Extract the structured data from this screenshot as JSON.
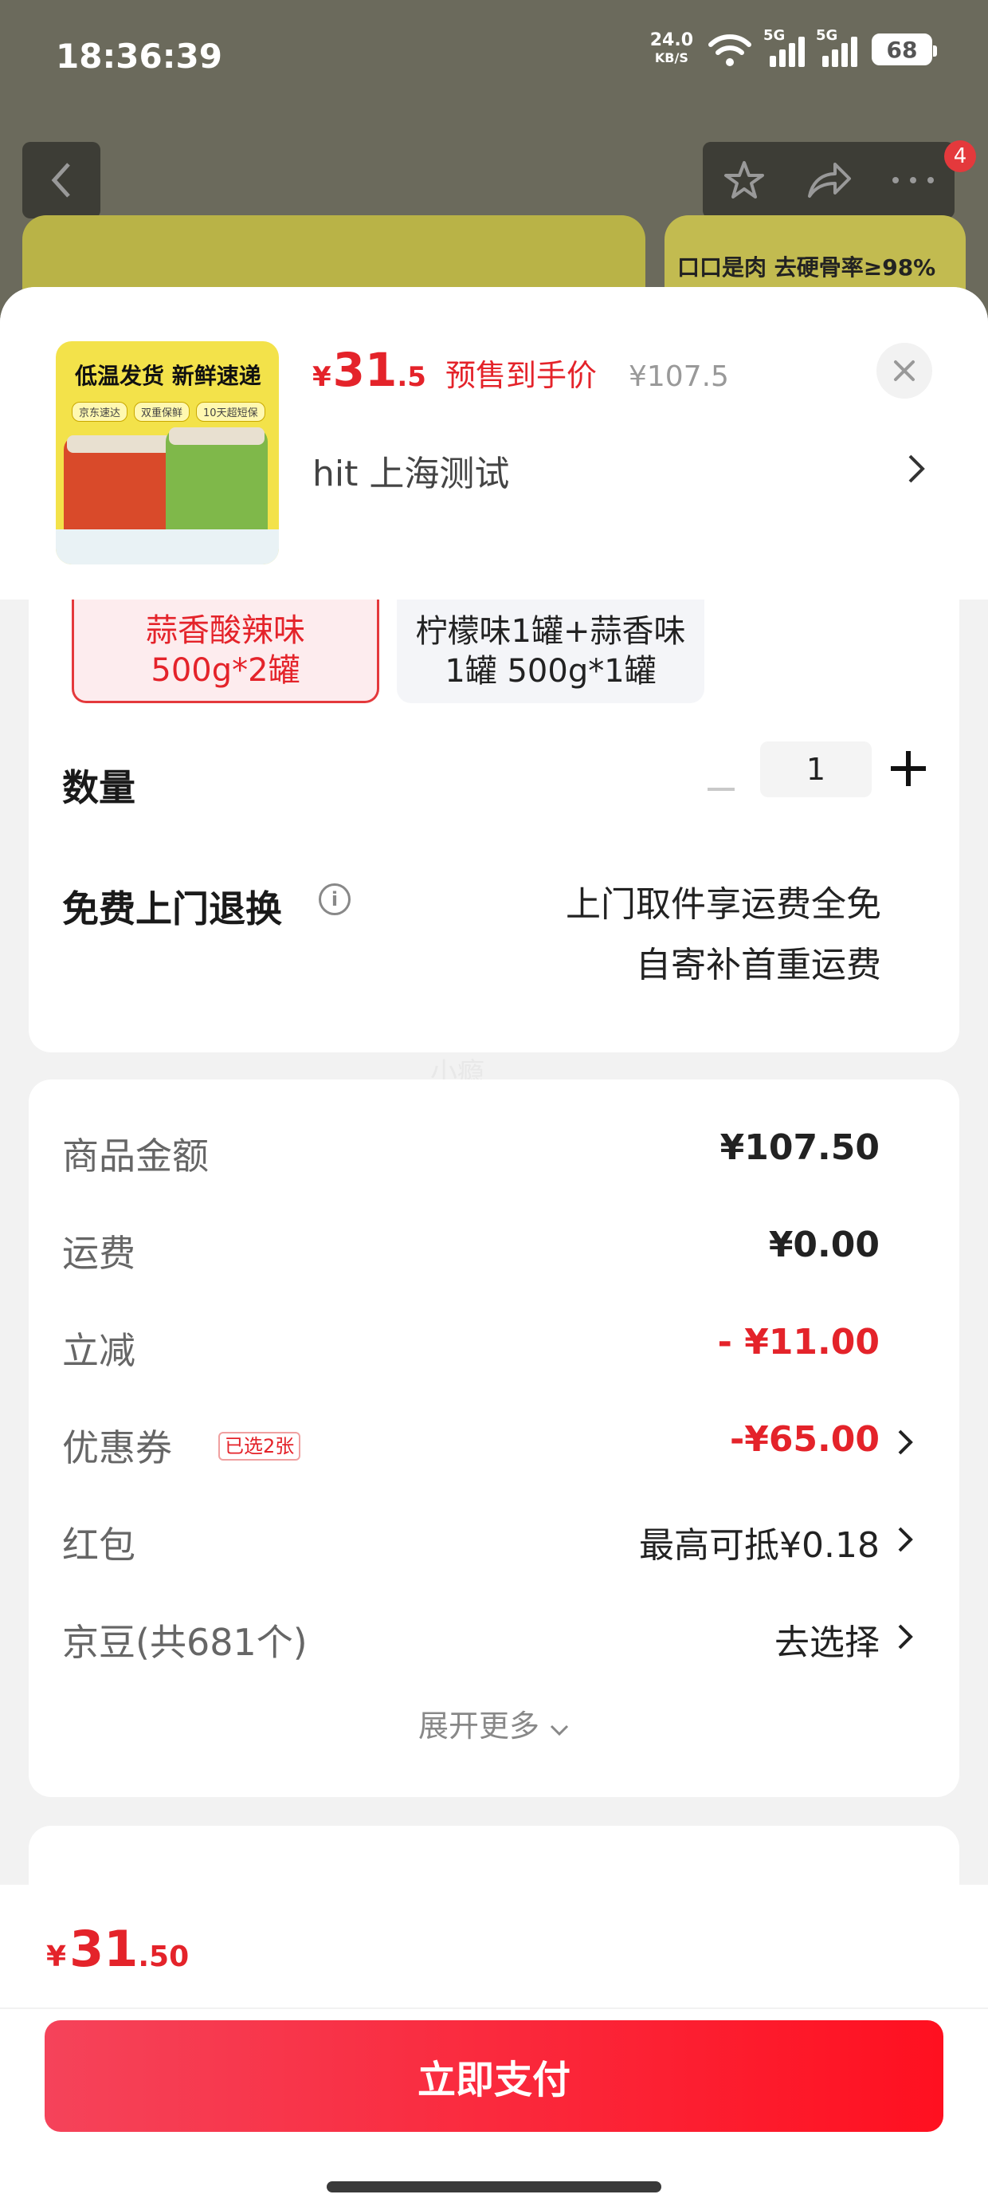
{
  "status_bar": {
    "time": "18:36:39",
    "speed_value": "24.0",
    "speed_unit": "KB/S",
    "sim1": "5G",
    "sim2": "5G",
    "battery": "68"
  },
  "background": {
    "badge_count": "4",
    "banner_text": "口口是肉 去硬骨率≥98%"
  },
  "product": {
    "image_title": "低温发货 新鲜速递",
    "image_tags": [
      "京东速达",
      "双重保鲜",
      "10天超短保"
    ],
    "price_currency": "¥",
    "price_integer": "31",
    "price_decimal": ".5",
    "presale_label": "预售到手价",
    "original_price": "¥107.5",
    "address": "hit  上海测试"
  },
  "options": [
    {
      "label_line1": "蒜香酸辣味",
      "label_line2": "500g*2罐",
      "selected": true
    },
    {
      "label_line1": "柠檬味1罐+蒜香味",
      "label_line2": "1罐 500g*1罐",
      "selected": false
    }
  ],
  "quantity": {
    "label": "数量",
    "value": "1"
  },
  "return_service": {
    "label": "免费上门退换",
    "line1": "上门取件享运费全免",
    "line2": "自寄补首重运费"
  },
  "watermark": "小瘾",
  "fees": {
    "rows": [
      {
        "label": "商品金额",
        "value": "¥107.50"
      },
      {
        "label": "运费",
        "value": "¥0.00"
      },
      {
        "label": "立减",
        "value": "- ¥11.00"
      },
      {
        "label": "优惠券",
        "tag": "已选2张",
        "value": "-¥65.00"
      },
      {
        "label": "红包",
        "value": "最高可抵¥0.18"
      },
      {
        "label": "京豆(共681个)",
        "value": "去选择"
      }
    ],
    "expand_label": "展开更多"
  },
  "footer": {
    "price_currency": "¥",
    "price_integer": "31",
    "price_decimal": ".50",
    "pay_label": "立即支付"
  },
  "colors": {
    "accent_red": "#e4232a",
    "pay_gradient_start": "#f5435a",
    "pay_gradient_end": "#ff1020"
  }
}
